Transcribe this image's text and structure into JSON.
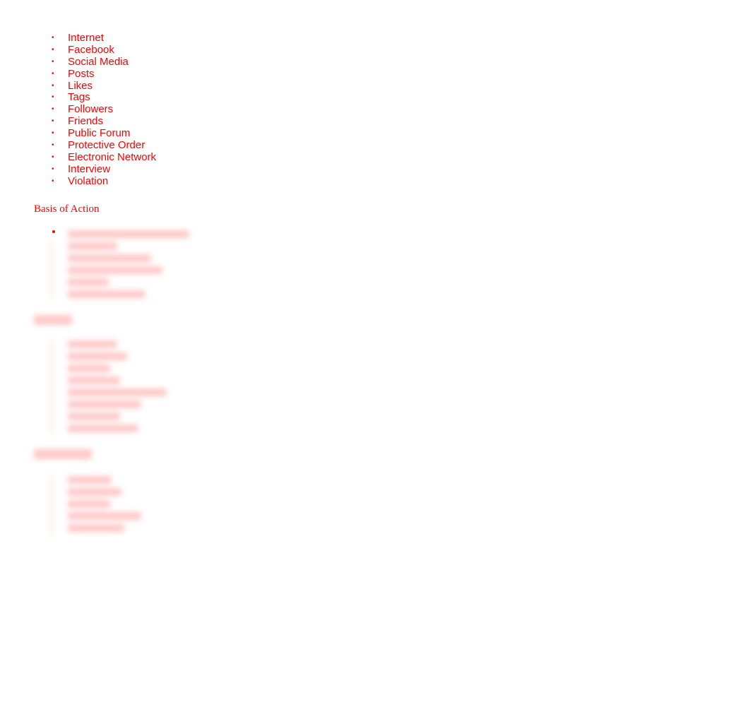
{
  "terms_list": {
    "items": [
      {
        "label": "Internet"
      },
      {
        "label": "Facebook"
      },
      {
        "label": "Social Media"
      },
      {
        "label": "Posts"
      },
      {
        "label": "Likes"
      },
      {
        "label": "Tags"
      },
      {
        "label": "Followers"
      },
      {
        "label": "Friends"
      },
      {
        "label": "Public Forum"
      },
      {
        "label": "Protective Order"
      },
      {
        "label": "Electronic Network"
      },
      {
        "label": "Interview"
      },
      {
        "label": "Violation"
      }
    ],
    "bullet": "•"
  },
  "section": {
    "heading": "Basis of Action"
  },
  "colors": {
    "text": "#ff0000",
    "background": "#ffffff"
  }
}
